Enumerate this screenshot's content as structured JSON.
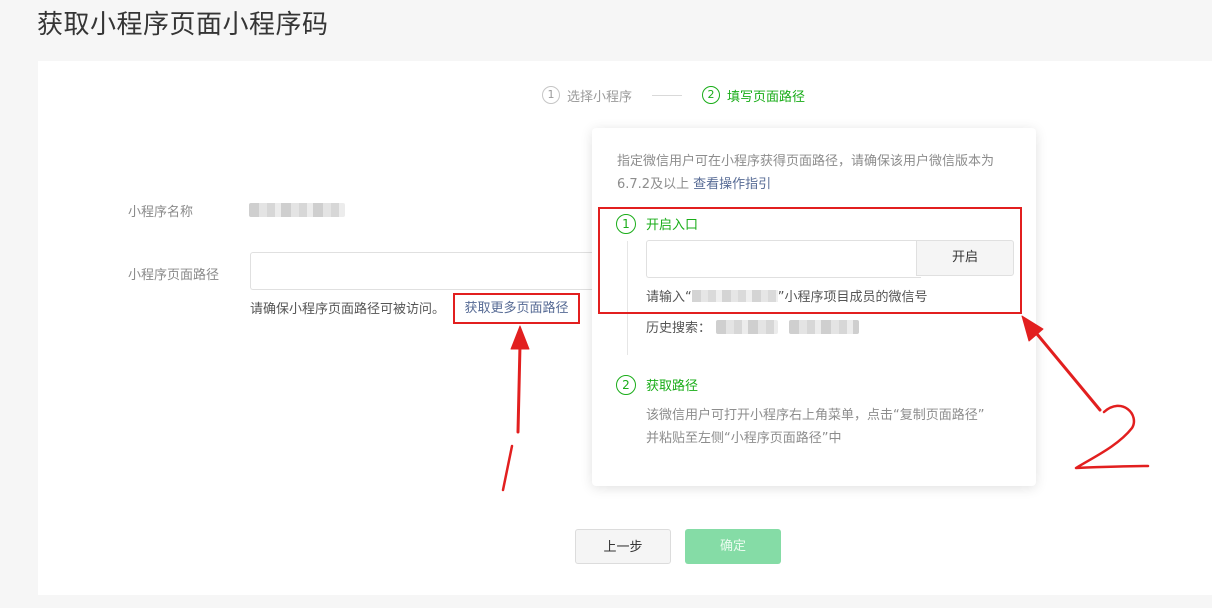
{
  "page_title": "获取小程序页面小程序码",
  "steps": [
    {
      "num": "1",
      "label": "选择小程序"
    },
    {
      "num": "2",
      "label": "填写页面路径"
    }
  ],
  "form": {
    "name_label": "小程序名称",
    "path_label": "小程序页面路径",
    "path_value": "",
    "hint": "请确保小程序页面路径可被访问。",
    "more_link": "获取更多页面路径"
  },
  "popover": {
    "desc": "指定微信用户可在小程序获得页面路径，请确保该用户微信版本为6.7.2及以上",
    "guide_link": "查看操作指引",
    "step1": {
      "num": "1",
      "title": "开启入口",
      "input_value": "",
      "button": "开启",
      "note_prefix": "请输入“",
      "note_suffix": "”小程序项目成员的微信号",
      "history_label": "历史搜索："
    },
    "step2": {
      "num": "2",
      "title": "获取路径",
      "line1": "该微信用户可打开小程序右上角菜单，点击“复制页面路径”",
      "line2": "并粘贴至左侧“小程序页面路径”中"
    }
  },
  "buttons": {
    "prev": "上一步",
    "confirm": "确定"
  },
  "colors": {
    "accent_green": "#1aad19",
    "link_blue": "#576b95",
    "annotation_red": "#e21f1f",
    "confirm_disabled": "#85dca6"
  }
}
